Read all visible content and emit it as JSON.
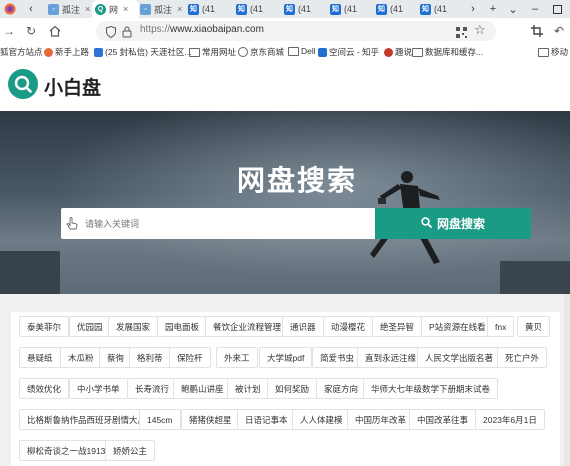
{
  "browser": {
    "tabs": [
      {
        "label": "孤注",
        "icon": "page-icon",
        "active": false
      },
      {
        "label": "网",
        "icon": "xiaobaipan-favicon",
        "active": true
      },
      {
        "label": "孤注",
        "icon": "page-icon",
        "active": false
      },
      {
        "label": "(41",
        "icon": "zhihu-icon",
        "active": false
      },
      {
        "label": "(41",
        "icon": "zhihu-icon",
        "active": false
      },
      {
        "label": "(41",
        "icon": "zhihu-icon",
        "active": false
      },
      {
        "label": "(41",
        "icon": "zhihu-icon",
        "active": false
      },
      {
        "label": "(41",
        "icon": "zhihu-icon",
        "active": false
      },
      {
        "label": "(41",
        "icon": "zhihu-icon",
        "active": false
      }
    ],
    "new_tab_symbol": "+",
    "url_protocol": "https://",
    "url_host": "www.xiaobaipan.com",
    "bookmarks": [
      {
        "label": "狐官方站点",
        "icon": "firefox-icon"
      },
      {
        "label": "新手上路",
        "icon": "firefox-icon"
      },
      {
        "label": "(25 封私信) 天涯社区...",
        "icon": "tianya-icon"
      },
      {
        "label": "常用网址",
        "icon": "folder-icon"
      },
      {
        "label": "京东商城",
        "icon": "globe-icon"
      },
      {
        "label": "Dell",
        "icon": "folder-icon"
      },
      {
        "label": "空间云 - 知乎",
        "icon": "zhihu-icon"
      },
      {
        "label": "趣说",
        "icon": "qushuo-icon"
      },
      {
        "label": "数据库和缓存...",
        "icon": "folder-icon"
      },
      {
        "label": "移动",
        "icon": "folder-icon"
      }
    ]
  },
  "site": {
    "title": "小白盘",
    "hero_title": "网盘搜索",
    "search_placeholder": "请输入关键词",
    "search_button": "网盘搜索"
  },
  "tags": [
    "泰美菲尔",
    "优园园",
    "发展国家",
    "园电面板",
    "餐饮企业流程管理",
    "通识器",
    "动漫樱花",
    "绝圣异智",
    "P站资源在线看",
    "fnx",
    "黄贝",
    "悬疑纸",
    "木瓜粉",
    "蔡徇",
    "格利蒂",
    "保险杆",
    "外来工",
    "大学城pdf",
    "简爱书虫",
    "直到永远注缘",
    "人民文学出版名著",
    "死亡户外",
    "绩效优化",
    "中小学书单",
    "长寿流行",
    "鲍鹏山讲座",
    "被计划",
    "如何奖励",
    "家庭方向",
    "华师大七年级数学下册期末试卷",
    "比格斯鲁纳作品西班牙剧情大片",
    "145cm",
    "猪猪侠超星",
    "日语记事本",
    "人人体建模",
    "中国历年改革",
    "中国改革往事",
    "2023年6月1日",
    "柳松奇谈之一战1913",
    "娇娇公主"
  ],
  "colors": {
    "accent": "#1a9b86"
  }
}
